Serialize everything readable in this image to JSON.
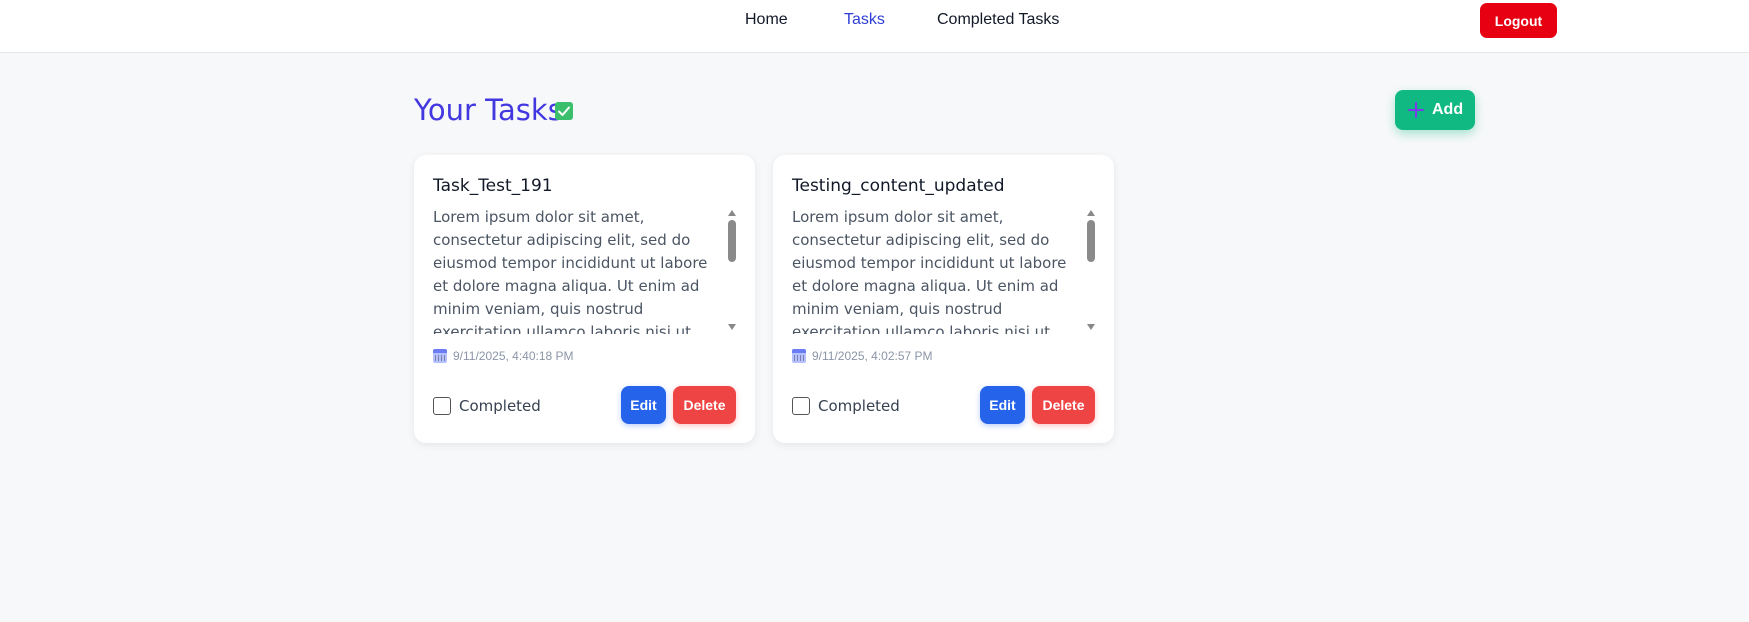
{
  "nav": {
    "links": [
      {
        "label": "Home"
      },
      {
        "label": "Tasks"
      },
      {
        "label": "Completed Tasks"
      }
    ],
    "active": "Tasks",
    "logout_label": "Logout"
  },
  "header": {
    "title": "Your Tasks",
    "title_icon": "check-square-icon",
    "add_label": "Add",
    "add_icon": "plus-icon"
  },
  "tasks": [
    {
      "title": "Task_Test_191",
      "description": "Lorem ipsum dolor sit amet, consectetur adipiscing elit, sed do eiusmod tempor incididunt ut labore et dolore magna aliqua. Ut enim ad minim veniam, quis nostrud exercitation ullamco laboris nisi ut aliquip ex ea commodo consequat.",
      "date": "9/11/2025, 4:40:18 PM",
      "completed_label": "Completed",
      "completed": false,
      "edit_label": "Edit",
      "delete_label": "Delete"
    },
    {
      "title": "Testing_content_updated",
      "description": "Lorem ipsum dolor sit amet, consectetur adipiscing elit, sed do eiusmod tempor incididunt ut labore et dolore magna aliqua. Ut enim ad minim veniam, quis nostrud exercitation ullamco laboris nisi ut aliquip ex ea commodo consequat.",
      "date": "9/11/2025, 4:02:57 PM",
      "completed_label": "Completed",
      "completed": false,
      "edit_label": "Edit",
      "delete_label": "Delete"
    }
  ],
  "colors": {
    "accent": "#4338e0",
    "active_nav": "#2f3fd6",
    "logout": "#e60012",
    "add": "#10b981",
    "edit": "#2563eb",
    "delete": "#ef4444"
  }
}
